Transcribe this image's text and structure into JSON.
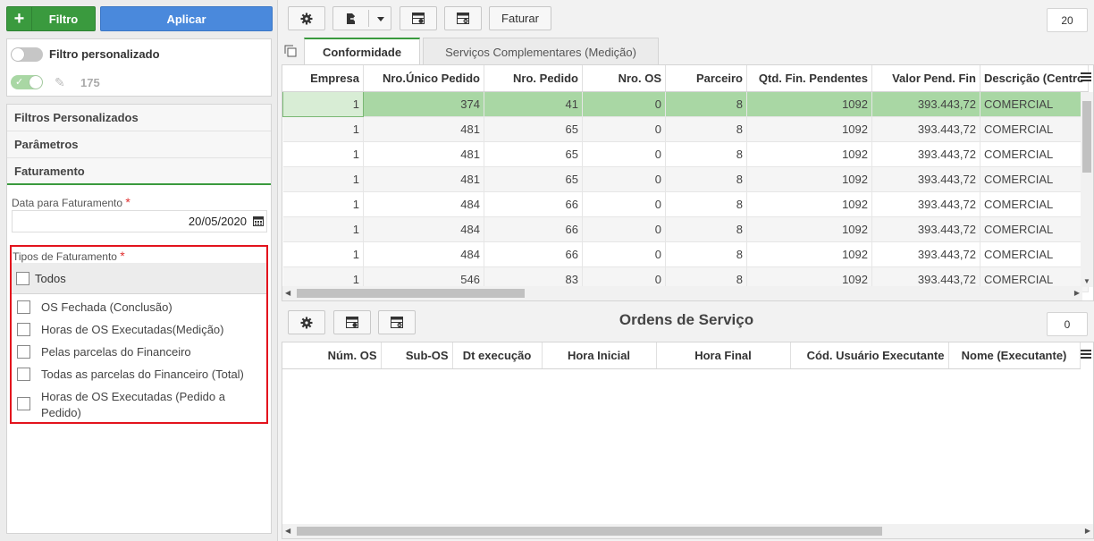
{
  "left": {
    "filtro_label": "Filtro",
    "aplicar_label": "Aplicar",
    "filtro_personalizado_label": "Filtro personalizado",
    "filtro_count": "175",
    "accordion": [
      "Filtros Personalizados",
      "Parâmetros",
      "Faturamento"
    ],
    "data_label": "Data para Faturamento",
    "data_value": "20/05/2020",
    "tipos_label": "Tipos de Faturamento",
    "todos_label": "Todos",
    "options": [
      "OS Fechada (Conclusão)",
      "Horas de OS Executadas(Medição)",
      "Pelas parcelas do Financeiro",
      "Todas as parcelas do Financeiro (Total)",
      "Horas de OS Executadas (Pedido a Pedido)"
    ],
    "required_mark": "*"
  },
  "toolbar": {
    "faturar_label": "Faturar",
    "page_size": "20"
  },
  "tabs": [
    "Conformidade",
    "Serviços Complementares (Medição)"
  ],
  "grid1": {
    "columns": [
      "Empresa",
      "Nro.Único Pedido",
      "Nro. Pedido",
      "Nro. OS",
      "Parceiro",
      "Qtd. Fin. Pendentes",
      "Valor Pend. Fin",
      "Descrição (Centro"
    ],
    "rows": [
      [
        "1",
        "374",
        "41",
        "0",
        "8",
        "1092",
        "393.443,72",
        "COMERCIAL"
      ],
      [
        "1",
        "481",
        "65",
        "0",
        "8",
        "1092",
        "393.443,72",
        "COMERCIAL"
      ],
      [
        "1",
        "481",
        "65",
        "0",
        "8",
        "1092",
        "393.443,72",
        "COMERCIAL"
      ],
      [
        "1",
        "481",
        "65",
        "0",
        "8",
        "1092",
        "393.443,72",
        "COMERCIAL"
      ],
      [
        "1",
        "484",
        "66",
        "0",
        "8",
        "1092",
        "393.443,72",
        "COMERCIAL"
      ],
      [
        "1",
        "484",
        "66",
        "0",
        "8",
        "1092",
        "393.443,72",
        "COMERCIAL"
      ],
      [
        "1",
        "484",
        "66",
        "0",
        "8",
        "1092",
        "393.443,72",
        "COMERCIAL"
      ],
      [
        "1",
        "546",
        "83",
        "0",
        "8",
        "1092",
        "393.443,72",
        "COMERCIAL"
      ]
    ]
  },
  "section2": {
    "title": "Ordens de Serviço",
    "count": "0",
    "columns": [
      "Núm. OS",
      "Sub-OS",
      "Dt execução",
      "Hora Inicial",
      "Hora Final",
      "Cód. Usuário Executante",
      "Nome (Executante)"
    ]
  },
  "colors": {
    "green": "#3a9a3e",
    "blue": "#4a89dc",
    "selected_row": "#a9d7a4",
    "highlight_border": "#e3131d"
  }
}
